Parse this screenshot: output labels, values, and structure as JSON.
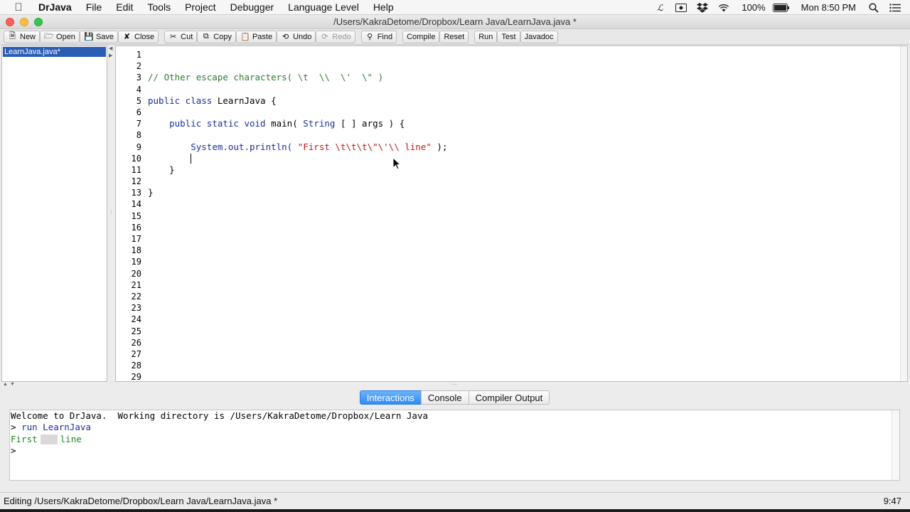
{
  "menubar": {
    "app_name": "DrJava",
    "items": [
      "File",
      "Edit",
      "Tools",
      "Project",
      "Debugger",
      "Language Level",
      "Help"
    ],
    "battery": "100%",
    "clock": "Mon 8:50 PM"
  },
  "window": {
    "title": "/Users/KakraDetome/Dropbox/Learn Java/LearnJava.java *"
  },
  "toolbar": {
    "new": "New",
    "open": "Open",
    "save": "Save",
    "close": "Close",
    "cut": "Cut",
    "copy": "Copy",
    "paste": "Paste",
    "undo": "Undo",
    "redo": "Redo",
    "find": "Find",
    "compile": "Compile",
    "reset": "Reset",
    "run": "Run",
    "test": "Test",
    "javadoc": "Javadoc"
  },
  "documents": [
    "LearnJava.java*"
  ],
  "editor": {
    "line_numbers": [
      "1",
      "2",
      "3",
      "4",
      "5",
      "6",
      "7",
      "8",
      "9",
      "10",
      "11",
      "12",
      "13",
      "14",
      "15",
      "16",
      "17",
      "18",
      "19",
      "20",
      "21",
      "22",
      "23",
      "24",
      "25",
      "26",
      "27",
      "28",
      "29"
    ],
    "line3": "// Other escape characters( \\t  \\\\  \\'  \\\" )",
    "line5_kw": "public class",
    "line5_rest": " LearnJava {",
    "line7_indent": "    ",
    "line7_kw": "public static void",
    "line7_rest": " main( ",
    "line7_type": "String",
    "line7_end": " [ ] args ) {",
    "line9_indent": "        ",
    "line9_call": "System.out.println( ",
    "line9_str": "\"First \\t\\t\\t\\\"\\'\\\\ line\"",
    "line9_end": " );",
    "line10_indent": "        ",
    "line11": "    }",
    "line13": "}"
  },
  "tabs": [
    "Interactions",
    "Console",
    "Compiler Output"
  ],
  "interactions": {
    "welcome": "Welcome to DrJava.  Working directory is /Users/KakraDetome/Dropbox/Learn Java",
    "prompt1": "> ",
    "command": "run LearnJava",
    "out_first": "First",
    "out_line": "line",
    "prompt2": ">"
  },
  "status": {
    "text": "Editing /Users/KakraDetome/Dropbox/Learn Java/LearnJava.java *",
    "position": "9:47"
  }
}
